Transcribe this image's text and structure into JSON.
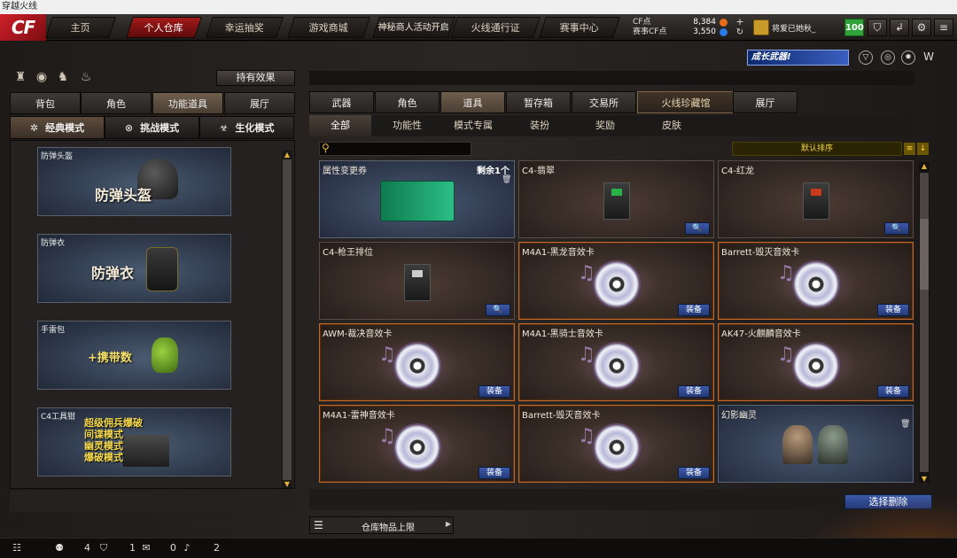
{
  "window": {
    "title": "穿越火线"
  },
  "topnav": {
    "tabs": [
      {
        "label": "主页"
      },
      {
        "label": "个人仓库"
      },
      {
        "label": "幸运抽奖"
      },
      {
        "label": "游戏商城"
      },
      {
        "label": "神秘商人活动开启"
      },
      {
        "label": "火线通行证"
      },
      {
        "label": "赛事中心"
      }
    ],
    "cf_point_label": "CF点",
    "cf_point_value": "8,384",
    "event_cf_label": "赛事CF点",
    "event_cf_value": "3,550",
    "player_name": "将爱已她秋_",
    "level": "100"
  },
  "left": {
    "hold_effect_label": "持有效果",
    "tabs": [
      {
        "label": "背包"
      },
      {
        "label": "角色"
      },
      {
        "label": "功能道具"
      },
      {
        "label": "展厅"
      }
    ],
    "modes": [
      {
        "label": "经典模式",
        "icon": "✲"
      },
      {
        "label": "挑战模式",
        "icon": "⊗"
      },
      {
        "label": "生化模式",
        "icon": "☣"
      }
    ],
    "slots": [
      {
        "title": "防弹头盔",
        "big": "防弹头盔"
      },
      {
        "title": "防弹衣",
        "big": "防弹衣"
      },
      {
        "title": "手雷包",
        "big": "+携带数"
      },
      {
        "title": "C4工具钳",
        "lines": [
          "超级佣兵爆破",
          "间谍模式",
          "幽灵模式",
          "爆破模式"
        ]
      }
    ]
  },
  "right": {
    "banner": "成长武器!",
    "tabs": [
      {
        "label": "武器"
      },
      {
        "label": "角色"
      },
      {
        "label": "道具"
      },
      {
        "label": "暂存箱"
      },
      {
        "label": "交易所"
      },
      {
        "label": "火线珍藏馆"
      },
      {
        "label": "展厅"
      }
    ],
    "subtabs": [
      {
        "label": "全部"
      },
      {
        "label": "功能性"
      },
      {
        "label": "模式专属"
      },
      {
        "label": "装扮"
      },
      {
        "label": "奖励"
      },
      {
        "label": "皮肤"
      }
    ],
    "search_placeholder": "",
    "sort_label": "默认排序",
    "equip_label": "装备",
    "items": [
      {
        "name": "属性变更券",
        "count": "剩余1个",
        "kind": "ticket"
      },
      {
        "name": "C4-翡翠",
        "kind": "c4"
      },
      {
        "name": "C4-红龙",
        "kind": "c4red"
      },
      {
        "name": "C4-枪王排位",
        "kind": "c4"
      },
      {
        "name": "M4A1-黑龙音效卡",
        "kind": "disc"
      },
      {
        "name": "Barrett-毁灭音效卡",
        "kind": "disc"
      },
      {
        "name": "AWM-裁决音效卡",
        "kind": "disc"
      },
      {
        "name": "M4A1-黑骑士音效卡",
        "kind": "disc"
      },
      {
        "name": "AK47-火麒麟音效卡",
        "kind": "disc"
      },
      {
        "name": "M4A1-雷神音效卡",
        "kind": "disc"
      },
      {
        "name": "Barrett-毁灭音效卡",
        "kind": "disc"
      },
      {
        "name": "幻影幽灵",
        "kind": "ghost"
      }
    ],
    "select_delete_label": "选择删除",
    "capacity_label": "仓库物品上限"
  },
  "statusbar": {
    "friends_count": "4",
    "team_count": "1",
    "chat_count": "0",
    "voice_count": "2"
  }
}
